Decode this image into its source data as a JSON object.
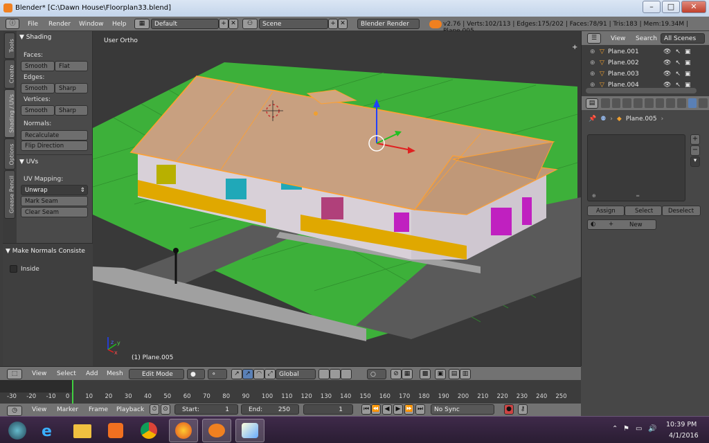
{
  "window": {
    "title": "Blender* [C:\\Dawn House\\Floorplan33.blend]"
  },
  "topmenu": {
    "file": "File",
    "render": "Render",
    "window": "Window",
    "help": "Help",
    "layout": "Default",
    "scene": "Scene",
    "engine": "Blender Render",
    "stats": "v2.76 | Verts:102/113 | Edges:175/202 | Faces:78/91 | Tris:183 | Mem:19.34M | Plane.005"
  },
  "toolshelf": {
    "tabs": [
      "Tools",
      "Create",
      "Shading / UVs",
      "Options",
      "Grease Pencil"
    ],
    "shading_title": "Shading",
    "faces_label": "Faces:",
    "edges_label": "Edges:",
    "vertices_label": "Vertices:",
    "smooth": "Smooth",
    "flat": "Flat",
    "sharp": "Sharp",
    "normals_label": "Normals:",
    "recalculate": "Recalculate",
    "flip_direction": "Flip Direction",
    "uvs_title": "UVs",
    "uv_mapping_label": "UV Mapping:",
    "unwrap": "Unwrap",
    "mark_seam": "Mark Seam",
    "clear_seam": "Clear Seam",
    "operator_title": "Make Normals Consiste",
    "inside": "Inside"
  },
  "viewport": {
    "view_label": "User Ortho",
    "object_label": "(1) Plane.005",
    "axis_x": "x",
    "axis_y": "y",
    "axis_z": "z"
  },
  "outliner": {
    "view": "View",
    "search": "Search",
    "all_scenes": "All Scenes",
    "items": [
      "Plane.001",
      "Plane.002",
      "Plane.003",
      "Plane.004"
    ]
  },
  "properties": {
    "object_name": "Plane.005",
    "assign": "Assign",
    "select": "Select",
    "deselect": "Deselect",
    "new": "New"
  },
  "view3d_header": {
    "view": "View",
    "select": "Select",
    "add": "Add",
    "mesh": "Mesh",
    "mode": "Edit Mode",
    "orientation": "Global"
  },
  "timeline": {
    "ticks": [
      "-30",
      "-20",
      "-10",
      "0",
      "10",
      "20",
      "30",
      "40",
      "50",
      "60",
      "70",
      "80",
      "90",
      "100",
      "110",
      "120",
      "130",
      "140",
      "150",
      "160",
      "170",
      "180",
      "190",
      "200",
      "210",
      "220",
      "230",
      "240",
      "250"
    ],
    "current_frame": "1"
  },
  "timeline_header": {
    "view": "View",
    "marker": "Marker",
    "frame": "Frame",
    "playback": "Playback",
    "start_label": "Start:",
    "start": "1",
    "end_label": "End:",
    "end": "250",
    "frame_value": "1",
    "sync": "No Sync"
  },
  "taskbar": {
    "time": "10:39 PM",
    "date": "4/1/2016"
  },
  "colors": {
    "grass": "#3db03a",
    "roof": "#c8a080",
    "wall": "#d8d0d8",
    "trim": "#e0a800",
    "selection": "#ffa030",
    "accent": "#5a80b6"
  }
}
